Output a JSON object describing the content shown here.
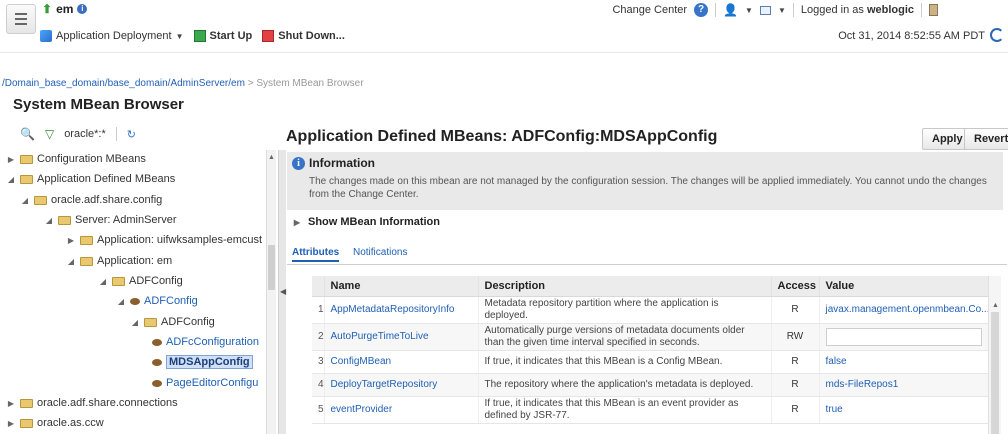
{
  "header": {
    "title": "em",
    "change_center": "Change Center",
    "logged_in_as": "Logged in as",
    "username": "weblogic"
  },
  "toolbar": {
    "app_deployment": "Application Deployment",
    "start_up": "Start Up",
    "shut_down": "Shut Down...",
    "timestamp": "Oct 31, 2014 8:52:55 AM PDT"
  },
  "breadcrumb": {
    "path": "/Domain_base_domain/base_domain/AdminServer/em",
    "current": " > System MBean Browser"
  },
  "page": {
    "title": "System MBean Browser"
  },
  "left_panel": {
    "filter_text": "oracle*:*",
    "tree": [
      {
        "label": "Configuration MBeans",
        "expanded": false,
        "kind": "folder"
      },
      {
        "label": "Application Defined MBeans",
        "expanded": true,
        "kind": "folder"
      },
      {
        "label": "oracle.adf.share.config",
        "expanded": true,
        "kind": "folder"
      },
      {
        "label": "Server: AdminServer",
        "expanded": true,
        "kind": "folder"
      },
      {
        "label": "Application: uifwksamples-emcust",
        "expanded": false,
        "kind": "folder"
      },
      {
        "label": "Application: em",
        "expanded": true,
        "kind": "folder"
      },
      {
        "label": "ADFConfig",
        "expanded": true,
        "kind": "folder"
      },
      {
        "label": "ADFConfig",
        "expanded": true,
        "kind": "bean"
      },
      {
        "label": "ADFConfig",
        "expanded": true,
        "kind": "folder"
      },
      {
        "label": "ADFcConfiguration",
        "kind": "bean"
      },
      {
        "label": "MDSAppConfig",
        "kind": "bean",
        "selected": true
      },
      {
        "label": "PageEditorConfigu",
        "kind": "bean"
      },
      {
        "label": "oracle.adf.share.connections",
        "expanded": false,
        "kind": "folder"
      },
      {
        "label": "oracle.as.ccw",
        "expanded": false,
        "kind": "folder"
      }
    ]
  },
  "main": {
    "title": "Application Defined MBeans: ADFConfig:MDSAppConfig",
    "apply_label": "Apply",
    "revert_label": "Revert",
    "info_title": "Information",
    "info_text": "The changes made on this mbean are not managed by the configuration session. The changes will be applied immediately. You cannot undo the changes from the Change Center.",
    "show_mbean_info": "Show MBean Information",
    "tabs": [
      {
        "label": "Attributes",
        "active": true
      },
      {
        "label": "Notifications",
        "active": false
      }
    ],
    "table": {
      "columns": [
        "",
        "Name",
        "Description",
        "Access",
        "Value"
      ],
      "rows": [
        {
          "num": "1",
          "name": "AppMetadataRepositoryInfo",
          "description": "Metadata repository partition where the application is deployed.",
          "access": "R",
          "value": "javax.management.openmbean.Co..."
        },
        {
          "num": "2",
          "name": "AutoPurgeTimeToLive",
          "description": "Automatically purge versions of metadata documents older than the given time interval specified in seconds.",
          "access": "RW",
          "value": ""
        },
        {
          "num": "3",
          "name": "ConfigMBean",
          "description": "If true, it indicates that this MBean is a Config MBean.",
          "access": "R",
          "value": "false"
        },
        {
          "num": "4",
          "name": "DeployTargetRepository",
          "description": "The repository where the application's metadata is deployed.",
          "access": "R",
          "value": "mds-FileRepos1"
        },
        {
          "num": "5",
          "name": "eventProvider",
          "description": "If true, it indicates that this MBean is an event provider as defined by JSR-77.",
          "access": "R",
          "value": "true"
        }
      ]
    }
  }
}
